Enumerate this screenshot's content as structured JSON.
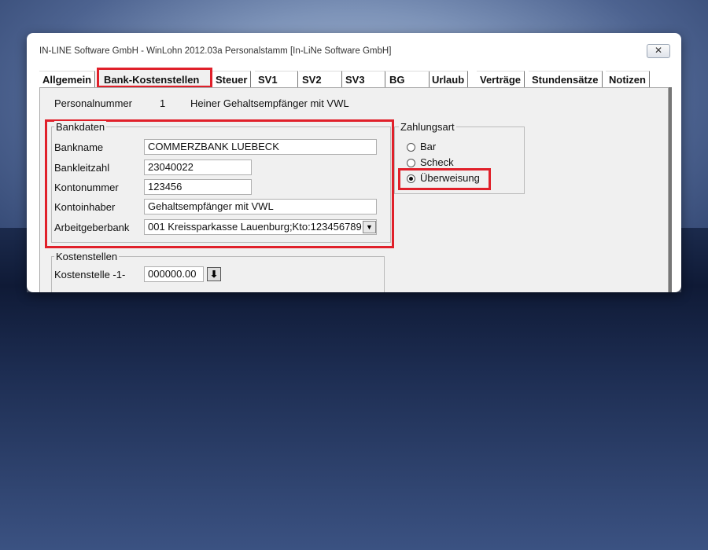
{
  "window": {
    "title": "IN-LINE Software GmbH - WinLohn 2012.03a  Personalstamm [In-LiNe Software GmbH]",
    "close_label": "✕"
  },
  "tabs": [
    {
      "label": "Allgemein"
    },
    {
      "label": "Bank-Kostenstellen",
      "active": true
    },
    {
      "label": "Steuer"
    },
    {
      "label": "SV1"
    },
    {
      "label": "SV2"
    },
    {
      "label": "SV3"
    },
    {
      "label": "BG"
    },
    {
      "label": "Urlaub"
    },
    {
      "label": "Verträge"
    },
    {
      "label": "Stundensätze"
    },
    {
      "label": "Notizen"
    }
  ],
  "employee": {
    "number_label": "Personalnummer",
    "number": "1",
    "name": "Heiner Gehaltsempfänger mit VWL"
  },
  "bankdaten": {
    "title": "Bankdaten",
    "bankname_label": "Bankname",
    "bankname": "COMMERZBANK LUEBECK",
    "blz_label": "Bankleitzahl",
    "blz": "23040022",
    "konto_label": "Kontonummer",
    "konto": "123456",
    "inhaber_label": "Kontoinhaber",
    "inhaber": "Gehaltsempfänger mit VWL",
    "arbeitgeberbank_label": "Arbeitgeberbank",
    "arbeitgeberbank": "001 Kreissparkasse Lauenburg;Kto:123456789"
  },
  "zahlungsart": {
    "title": "Zahlungsart",
    "options": [
      "Bar",
      "Scheck",
      "Überweisung"
    ],
    "selected": "Überweisung"
  },
  "kostenstellen": {
    "title": "Kostenstellen",
    "ks1_label": "Kostenstelle -1-",
    "ks1_value": "000000.00"
  },
  "colors": {
    "highlight": "#e0202a",
    "panel": "#f0f0f0"
  },
  "icons": {
    "close": "close-icon",
    "dropdown": "chevron-down-icon",
    "spin": "arrow-down-icon"
  }
}
